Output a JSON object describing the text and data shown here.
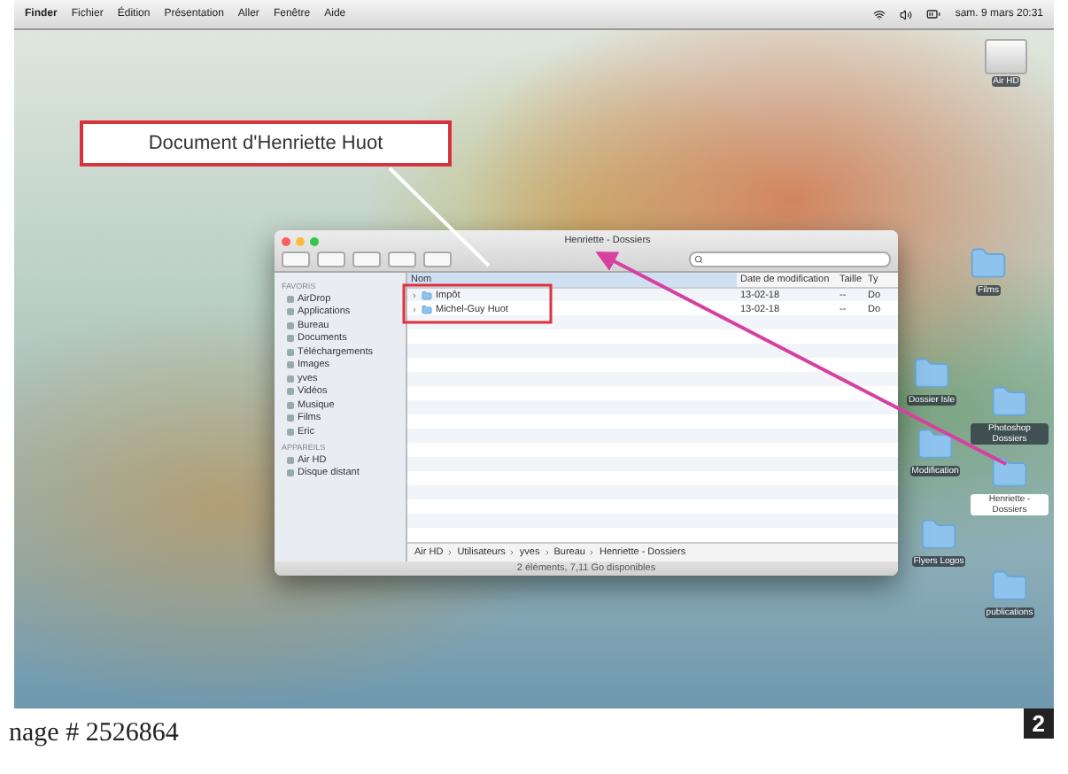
{
  "menu_bar": {
    "app": "Finder",
    "items": [
      "Fichier",
      "Édition",
      "Présentation",
      "Aller",
      "Fenêtre",
      "Aide"
    ],
    "clock": "sam. 9 mars 20:31"
  },
  "callout": {
    "label": "Document d'Henriette Huot"
  },
  "desktop_icons": [
    {
      "kind": "drive",
      "label": "Air HD",
      "selected": false
    },
    {
      "kind": "folder",
      "label": "Films",
      "selected": false
    },
    {
      "kind": "folder",
      "label": "Dossier Isle",
      "selected": false
    },
    {
      "kind": "folder",
      "label": "Photoshop Dossiers",
      "selected": false
    },
    {
      "kind": "folder",
      "label": "Modification",
      "selected": false
    },
    {
      "kind": "folder",
      "label": "Henriette - Dossiers",
      "selected": true
    },
    {
      "kind": "folder",
      "label": "Flyers Logos",
      "selected": false
    },
    {
      "kind": "folder",
      "label": "publications",
      "selected": false
    }
  ],
  "finder": {
    "title": "Henriette - Dossiers",
    "sidebar": [
      {
        "heading": "FAVORIS",
        "items": [
          "AirDrop",
          "Applications",
          "Bureau",
          "Documents",
          "Téléchargements",
          "Images",
          "yves",
          "Vidéos",
          "Musique",
          "Films",
          "Eric"
        ]
      },
      {
        "heading": "APPAREILS",
        "items": [
          "Air HD",
          "Disque distant"
        ]
      }
    ],
    "columns": [
      "Nom",
      "Date de modification",
      "Taille",
      "Ty"
    ],
    "rows": [
      {
        "name": "Impôt",
        "date": "13-02-18",
        "size": "--",
        "type": "Do"
      },
      {
        "name": "Michel-Guy Huot",
        "date": "13-02-18",
        "size": "--",
        "type": "Do"
      }
    ],
    "path": [
      "Air HD",
      "Utilisateurs",
      "yves",
      "Bureau",
      "Henriette - Dossiers"
    ],
    "status": "2 éléments, 7,11 Go disponibles"
  },
  "caption": "nage # 2526864",
  "figure_number": "2"
}
